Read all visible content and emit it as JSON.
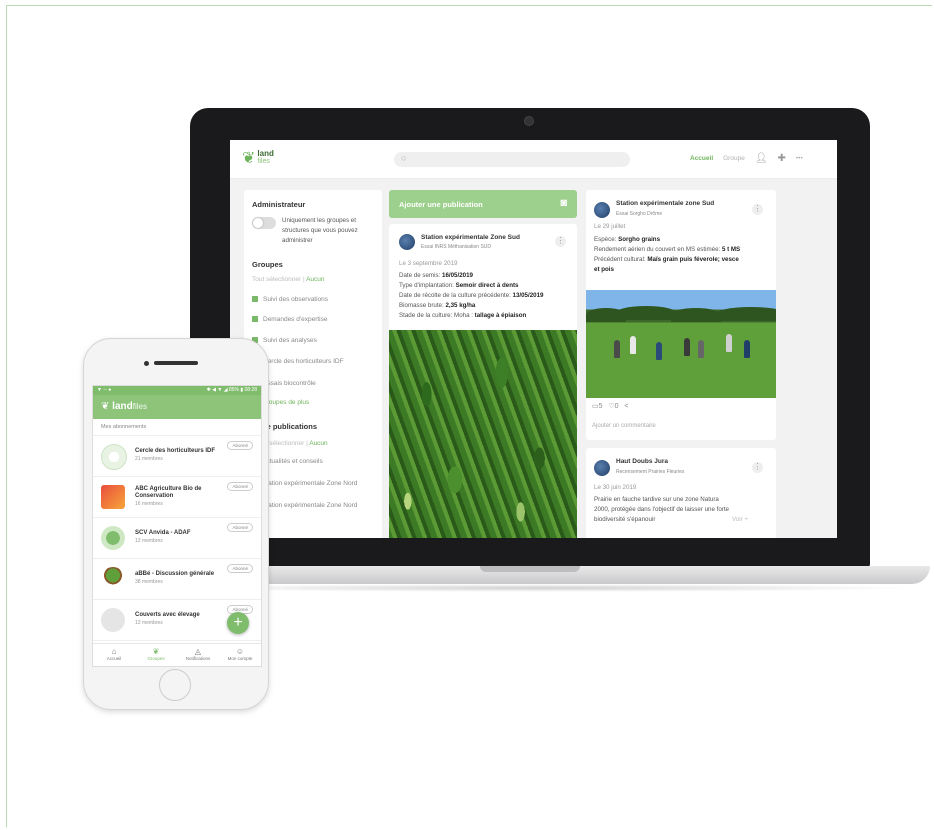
{
  "web": {
    "logo": {
      "line1": "land",
      "line2": "files"
    },
    "nav": {
      "home": "Accueil",
      "groups": "Groupe",
      "more": "•••"
    },
    "sidebar": {
      "admin_title": "Administrateur",
      "admin_toggle_text": "Uniquement les groupes et structures que vous pouvez administrer",
      "groups_title": "Groupes",
      "select_all": "Tout sélectionner",
      "none": "Aucun",
      "groups": [
        "Suivi des observations",
        "Demandes d'expertise",
        "Suivi des analyses",
        "Cercle des horticulteurs IDF",
        "Essais biocontrôle"
      ],
      "more_groups": "+ 3 groupes de plus",
      "pubs_title": "de publications",
      "select_all_2": "ut sélectionner",
      "none_2": "Aucun",
      "pubs": [
        "Actualités et conseils",
        "Station expérimentale Zone Nord",
        "Station expérimentale Zone Nord"
      ]
    },
    "add_publication": "Ajouter une publication",
    "post1": {
      "name": "Station expérimentale Zone Sud",
      "sub": "Essai INRS Méthanisation SUD",
      "date": "Le 3 septembre 2019",
      "lines": [
        {
          "label": "Date de semis: ",
          "value": "16/05/2019"
        },
        {
          "label": "Type d'implantation: ",
          "value": "Semoir direct à dents"
        },
        {
          "label": "Date de récolte de la culture précédente: ",
          "value": "13/05/2019"
        },
        {
          "label": "Biomasse brute: ",
          "value": "2,35 kg/ha"
        },
        {
          "label": "Stade de la culture: Moha : ",
          "value": "tallage à épiaison"
        }
      ]
    },
    "post2": {
      "name": "Station expérimentale zone Sud",
      "sub": "Essai Sorgho Drôme",
      "date": "Le 29 juillet",
      "lines": [
        {
          "label": "Espèce: ",
          "value": "Sorgho grains"
        },
        {
          "label": "Rendement aérien du couvert en MS estimée: ",
          "value": "5 t MS"
        },
        {
          "label": "Précédent cultural: ",
          "value": "Maïs grain puis féverole; vesce"
        },
        {
          "label": "",
          "value": "et pois"
        }
      ],
      "likes": "5",
      "comments": "0",
      "comment_placeholder": "Ajouter un commentaire"
    },
    "post3": {
      "name": "Haut Doubs Jura",
      "sub": "Recensement Prairies Fleuries",
      "date": "Le 30 juin 2019",
      "text": [
        "Prairie en fauche tardive sur une zone Natura",
        "2000, protégée dans l'objectif de laisser une forte",
        "biodiversité s'épanouir"
      ],
      "more": "Voir +"
    }
  },
  "mobile": {
    "status_left": "▼ ◦◦ ●",
    "status_right": "✱ ◀ ▼ ◢ 85% ▮ 08:28",
    "app_title_bold": "land",
    "app_title_light": "files",
    "section": "Mes abonnements",
    "groups": [
      {
        "name": "Cercle des horticulteurs IDF",
        "count": "21 membres",
        "btn": "Abonné"
      },
      {
        "name": "ABC Agriculture Bio de",
        "name2": "Conservation",
        "count": "16 membres",
        "btn": "Abonné"
      },
      {
        "name": "SCV Anvida - ADAF",
        "count": "13 membres",
        "btn": "Abonné"
      },
      {
        "name": "aBBé - Discussion générale",
        "count": "38 membres",
        "btn": "Abonné"
      },
      {
        "name": "Couverts avec élevage",
        "count": "13 membres",
        "btn": "Abonné"
      }
    ],
    "tabs": [
      "Accueil",
      "Groupes",
      "Notifications",
      "Mon compte"
    ]
  },
  "colors": {
    "accent": "#7fbd6c",
    "accent_light": "#9dd08c",
    "frame": "#bcd9b3"
  }
}
